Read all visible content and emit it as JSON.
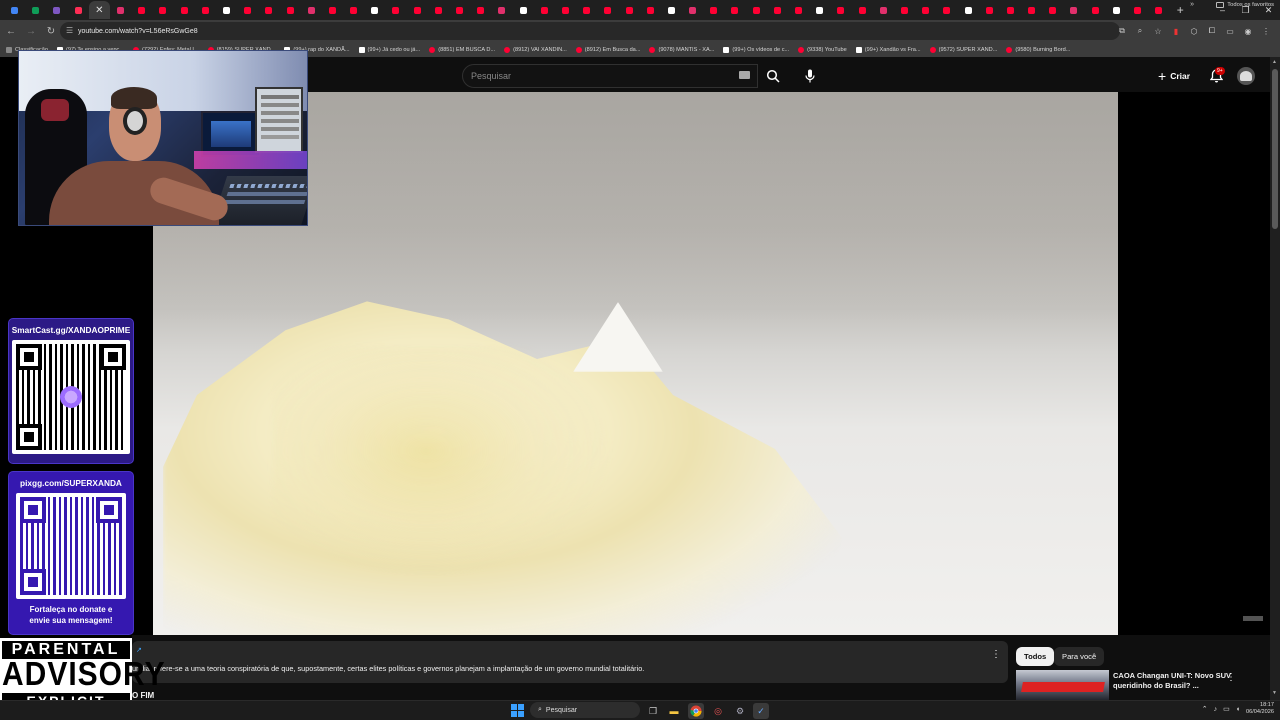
{
  "browser": {
    "address": "youtube.com/watch?v=L56eRsGwGe8",
    "tab_close": "✕",
    "new_tab": "+",
    "window_controls": [
      "–",
      "❐",
      "✕"
    ]
  },
  "bookmarks": {
    "items": [
      {
        "label": "Classificação",
        "icon": "folder"
      },
      {
        "label": "(97) Te ensino a venc...",
        "icon": "tiktok"
      },
      {
        "label": "(7292) Enfes: Metal I...",
        "icon": "youtube"
      },
      {
        "label": "(8159) SUPER XAND...",
        "icon": "youtube"
      },
      {
        "label": "(99+) rap do XANDÃ...",
        "icon": "tiktok"
      },
      {
        "label": "(99+) Já cedo ou já...",
        "icon": "tiktok"
      },
      {
        "label": "(8851) EM BUSCA D...",
        "icon": "youtube"
      },
      {
        "label": "(8912) VAI XANDIN...",
        "icon": "youtube"
      },
      {
        "label": "(8912) Em Busca da...",
        "icon": "youtube"
      },
      {
        "label": "(9078) MANTIS - XA...",
        "icon": "youtube"
      },
      {
        "label": "(99+) Os vídeos de c...",
        "icon": "tiktok"
      },
      {
        "label": "(9338) YouTube",
        "icon": "youtube"
      },
      {
        "label": "(99+) Xandão vs Fra...",
        "icon": "tiktok"
      },
      {
        "label": "(9572) SUPER XAND...",
        "icon": "youtube"
      },
      {
        "label": "(9580) Burning Bord...",
        "icon": "youtube"
      }
    ],
    "more": "»",
    "all_bookmarks": "Todos os favoritos"
  },
  "youtube": {
    "search_placeholder": "Pesquisar",
    "create_label": "Criar",
    "notifications_badge": "9+"
  },
  "overlays": {
    "donate1_head": "SmartCast.gg/XANDAOPRIME",
    "donate2_head": "pixgg.com/SUPERXANDA",
    "donate2_foot1": "Fortaleça no donate e",
    "donate2_foot2": "envie sua mensagem!",
    "advisory_l1": "PARENTAL",
    "advisory_l2": "ADVISORY",
    "advisory_l3": "EXPLICIT CONTENT"
  },
  "description": {
    "link": "↗",
    "text": "undial refere-se a uma teoria conspiratória de que, supostamente, certas elites políticas e governos planejam a implantação de um governo mundial totalitário.",
    "next_title": "O FIM",
    "menu": "⋮"
  },
  "sidebar": {
    "chips": [
      "Todos",
      "Para você"
    ],
    "rec_title": "CAOA Changan UNI-T: Novo SUV queridinho do Brasil? ...",
    "rec_menu": "⋮"
  },
  "taskbar": {
    "search": "Pesquisar",
    "time": "18:17",
    "date": "06/04/2026"
  }
}
